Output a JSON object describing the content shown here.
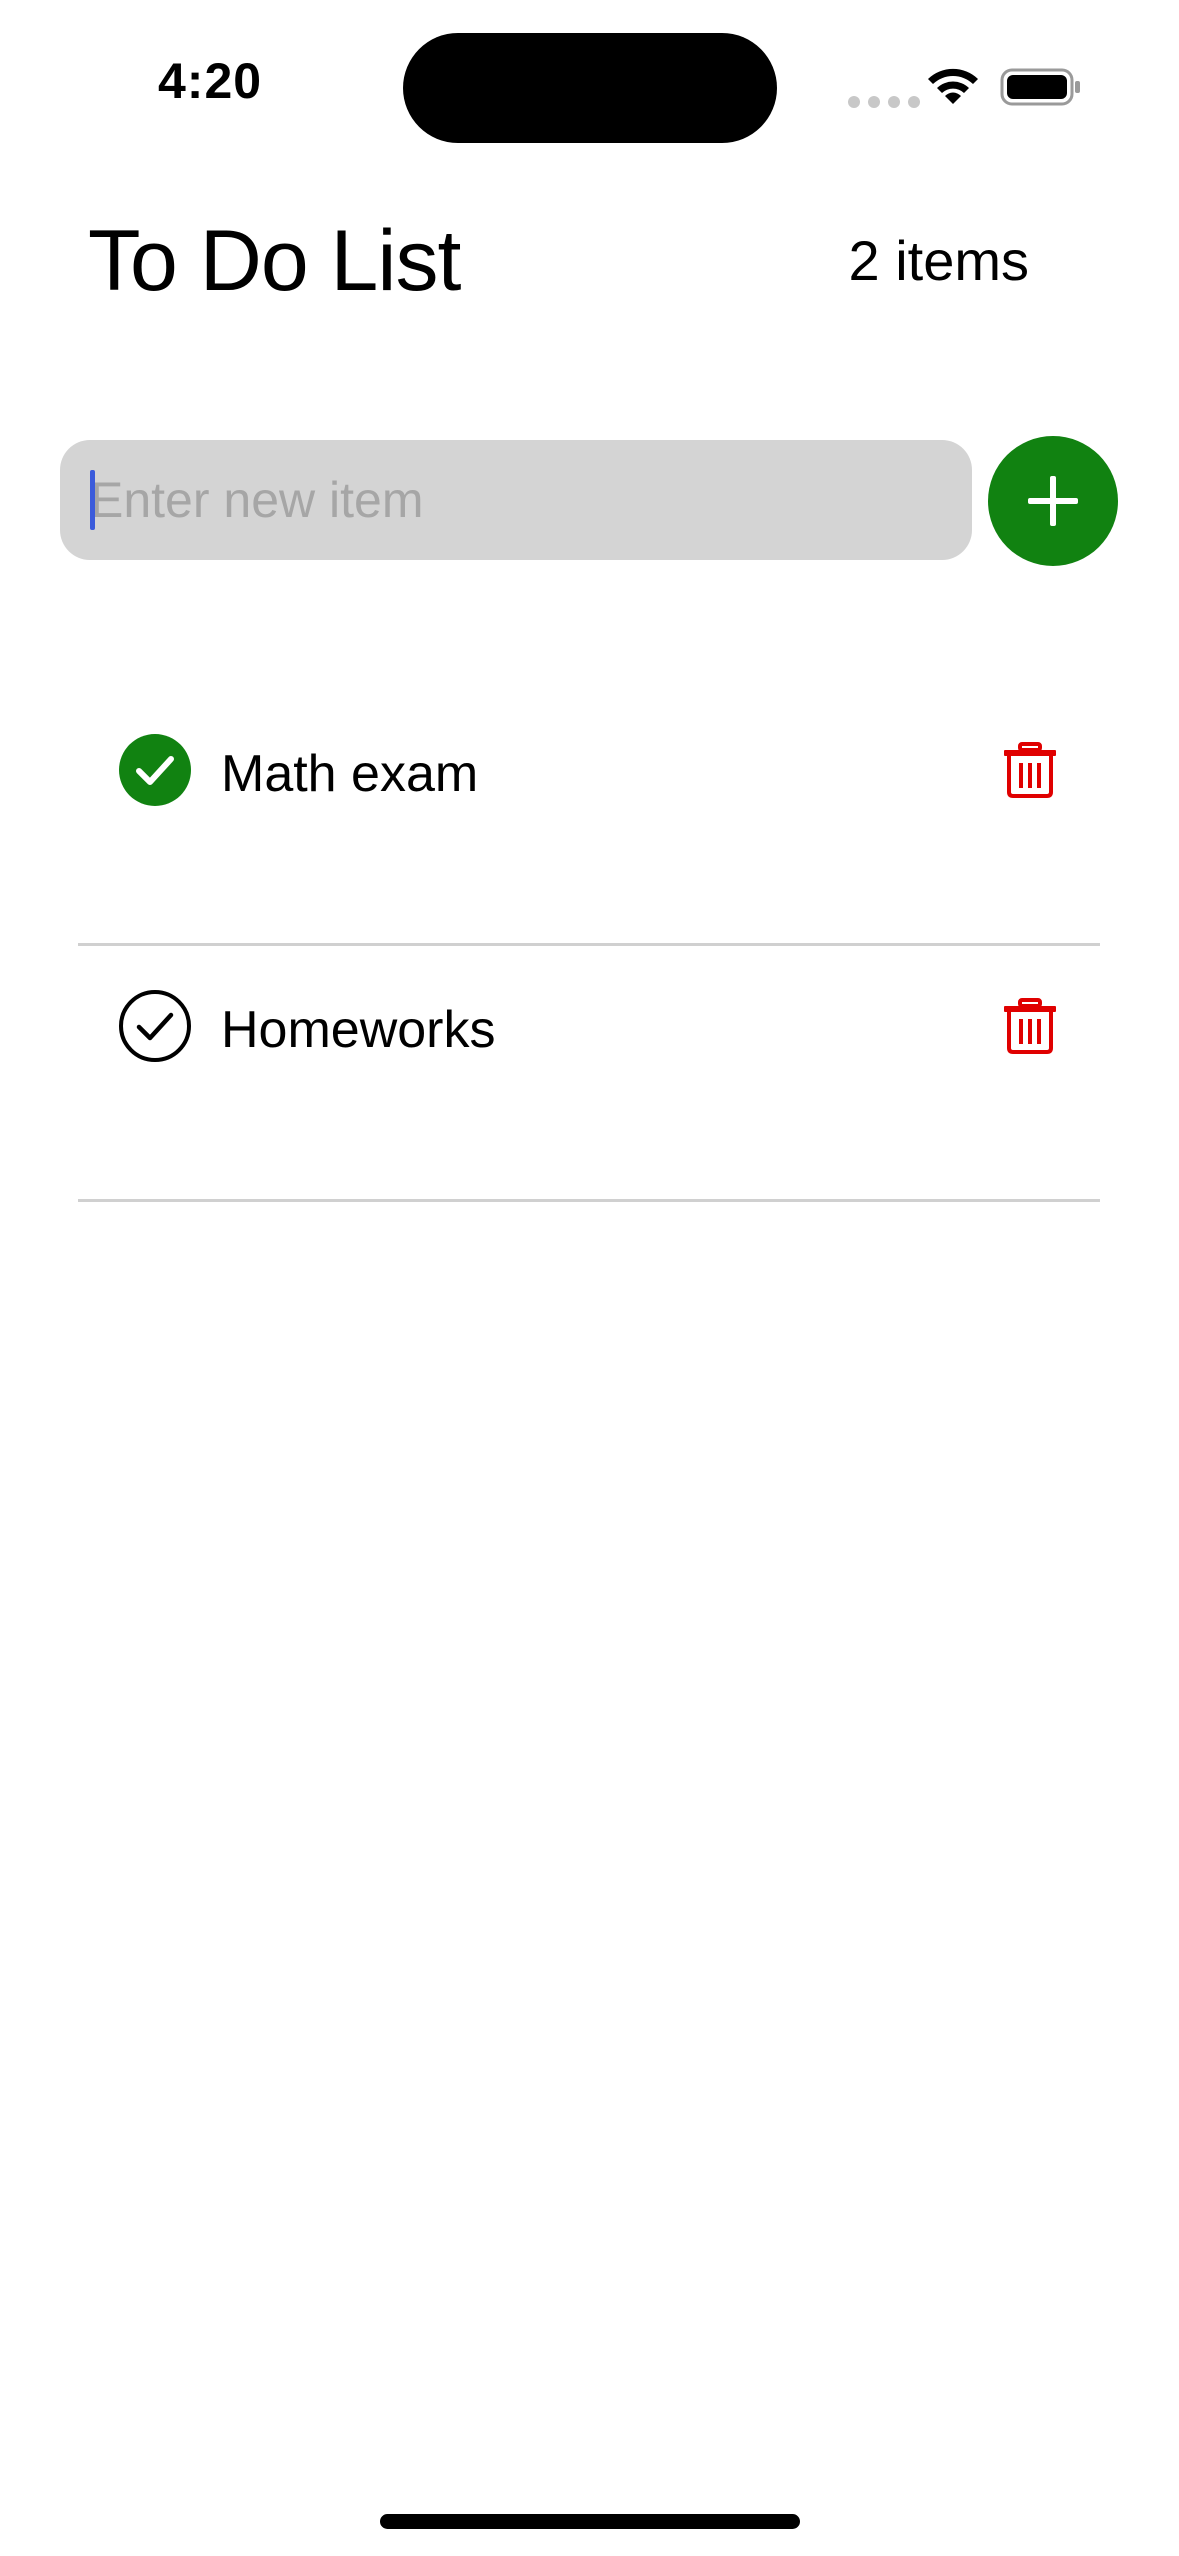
{
  "status_bar": {
    "time": "4:20",
    "icons": [
      "signal-icon",
      "wifi-icon",
      "battery-icon"
    ]
  },
  "header": {
    "title": "To Do List",
    "count_label": "2 items"
  },
  "input": {
    "placeholder": "Enter new item",
    "value": ""
  },
  "add_button": {
    "icon": "plus-icon"
  },
  "items": [
    {
      "label": "Math exam",
      "completed": true
    },
    {
      "label": "Homeworks",
      "completed": false
    }
  ],
  "colors": {
    "accent_green": "#118211",
    "delete_red": "#e00000",
    "input_bg": "#d4d4d4",
    "caret_blue": "#3b5bdb"
  }
}
